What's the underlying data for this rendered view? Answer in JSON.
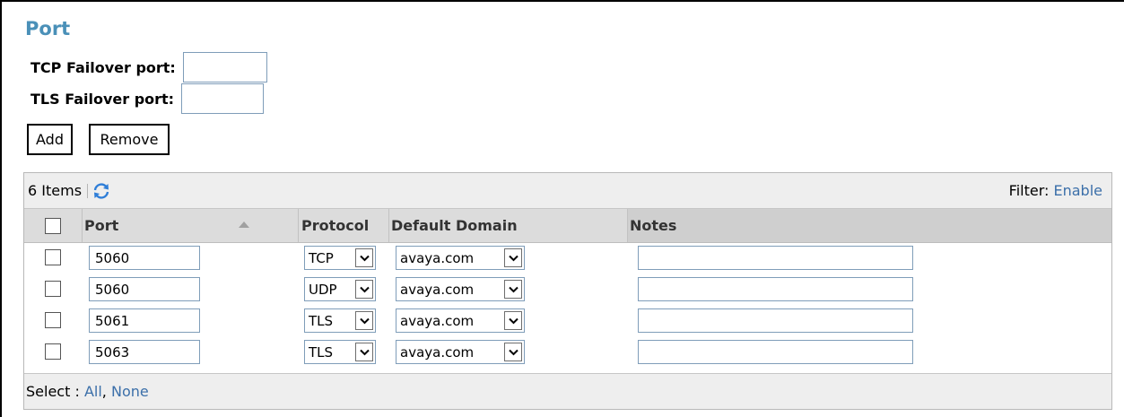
{
  "section": {
    "title": "Port"
  },
  "failover": {
    "tcp_label": "TCP Failover port:",
    "tcp_value": "",
    "tls_label": "TLS Failover port:",
    "tls_value": ""
  },
  "buttons": {
    "add": "Add",
    "remove": "Remove"
  },
  "grid": {
    "item_count": "6 Items",
    "filter_label": "Filter:",
    "filter_action": "Enable",
    "columns": {
      "port": "Port",
      "protocol": "Protocol",
      "default_domain": "Default Domain",
      "notes": "Notes"
    },
    "rows": [
      {
        "port": "5060",
        "protocol": "TCP",
        "domain": "avaya.com",
        "notes": ""
      },
      {
        "port": "5060",
        "protocol": "UDP",
        "domain": "avaya.com",
        "notes": ""
      },
      {
        "port": "5061",
        "protocol": "TLS",
        "domain": "avaya.com",
        "notes": ""
      },
      {
        "port": "5063",
        "protocol": "TLS",
        "domain": "avaya.com",
        "notes": ""
      }
    ],
    "footer": {
      "select_label": "Select :",
      "all": "All",
      "sep": ",",
      "none": "None"
    }
  },
  "colors": {
    "title": "#4a90b8",
    "link": "#3b6fa9",
    "refresh_icon": "#2f7ed8"
  },
  "icons": {
    "refresh": "refresh-icon",
    "dropdown": "chevron-down-icon",
    "sort": "sort-ascending-icon"
  }
}
